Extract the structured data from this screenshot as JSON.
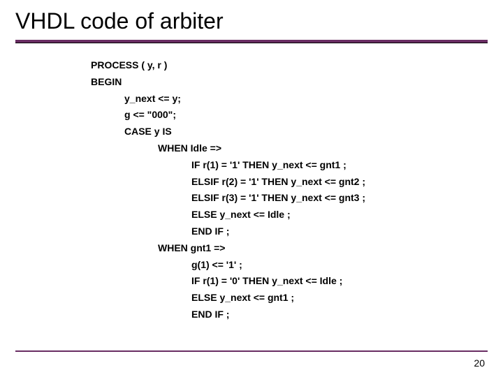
{
  "title": "VHDL code of arbiter",
  "lines": [
    {
      "indent": 0,
      "text": "PROCESS ( y, r )"
    },
    {
      "indent": 0,
      "text": "BEGIN"
    },
    {
      "indent": 1,
      "text": "y_next <= y;"
    },
    {
      "indent": 1,
      "text": "g <= \"000\";"
    },
    {
      "indent": 1,
      "text": "CASE y IS"
    },
    {
      "indent": 2,
      "text": "WHEN Idle =>"
    },
    {
      "indent": 3,
      "text": "IF r(1) = '1' THEN y_next <= gnt1 ;"
    },
    {
      "indent": 3,
      "text": "ELSIF r(2) = '1' THEN y_next <= gnt2 ;"
    },
    {
      "indent": 3,
      "text": "ELSIF r(3) = '1' THEN y_next <= gnt3 ;"
    },
    {
      "indent": 3,
      "text": "ELSE y_next <= Idle ;"
    },
    {
      "indent": 3,
      "text": "END IF ;"
    },
    {
      "indent": 2,
      "text": "WHEN gnt1 =>"
    },
    {
      "indent": 3,
      "text": "g(1) <= '1' ;"
    },
    {
      "indent": 3,
      "text": "IF r(1) = '0' THEN y_next <= Idle ;"
    },
    {
      "indent": 3,
      "text": "ELSE y_next <= gnt1 ;"
    },
    {
      "indent": 3,
      "text": "END IF ;"
    }
  ],
  "page_number": "20"
}
